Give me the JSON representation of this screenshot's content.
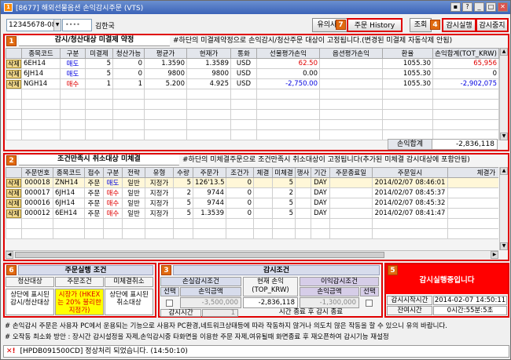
{
  "window": {
    "title": "[8677] 해외선물옵션 손익감시주문 (VTS)"
  },
  "topbar": {
    "account": "12345678-08",
    "password_mask": "••••",
    "user_name": "김한국",
    "notice_button": "유의사항",
    "history_button": "주문 History",
    "lookup_button": "조회",
    "start_button": "감시실행",
    "stop_button": "감시중지"
  },
  "badges": {
    "history": "7",
    "run": "4",
    "p1": "1",
    "p2": "2",
    "p6": "6",
    "p3": "3",
    "p5": "5"
  },
  "panel1": {
    "title": "감시/청산대상 미결제 약정",
    "note": "#하단의 미결제약정으로 손익감시/청산주문 대상이 고정됩니다.(변경된 미결제 자동삭제 안됨)",
    "columns": [
      "",
      "종목코드",
      "구분",
      "미결제",
      "청산가능",
      "평균가",
      "현재가",
      "통화",
      "선물평가손익",
      "옵션평가손익",
      "환율",
      "손익합계(TOT_KRW)"
    ],
    "rows": [
      {
        "del": "삭제",
        "code": "6EH14",
        "side": "매도",
        "open": "5",
        "avail": "0",
        "avg": "1.3590",
        "cur": "1.3589",
        "ccy": "USD",
        "fut_pl": "62.50",
        "opt_pl": "",
        "fx": "1055.30",
        "total": "65,956"
      },
      {
        "del": "삭제",
        "code": "6JH14",
        "side": "매도",
        "open": "5",
        "avail": "0",
        "avg": "9800",
        "cur": "9800",
        "ccy": "USD",
        "fut_pl": "0.00",
        "opt_pl": "",
        "fx": "1055.30",
        "total": "0"
      },
      {
        "del": "삭제",
        "code": "NGH14",
        "side": "매수",
        "open": "1",
        "avail": "1",
        "avg": "5.200",
        "cur": "4.925",
        "ccy": "USD",
        "fut_pl": "-2,750.00",
        "opt_pl": "",
        "fx": "1055.30",
        "total": "-2,902,075"
      }
    ],
    "sum_label": "손익합계",
    "sum_value": "-2,836,118"
  },
  "panel2": {
    "title": "조건만족시 취소대상 미체결",
    "note": "#하단의 미체결주문으로 조건만족시 취소대상이 고정됩니다(추가된 미체결 감시대상에 포함안됨)",
    "columns": [
      "",
      "주문번호",
      "종목코드",
      "접수",
      "구분",
      "전략",
      "유형",
      "수량",
      "주문가",
      "조건가",
      "체결",
      "미체결",
      "행사",
      "기간",
      "주문종료일",
      "주문일시",
      "체결가"
    ],
    "rows": [
      {
        "del": "삭제",
        "no": "000018",
        "code": "ZNH14",
        "rcv": "주문",
        "side": "매도",
        "strat": "일반",
        "type": "지정가",
        "qty": "5",
        "price": "126'13.5",
        "cond": "0",
        "fill": "",
        "unfilled": "5",
        "ex": "",
        "period": "DAY",
        "end": "",
        "time": "2014/02/07 08:46:01",
        "fillp": ""
      },
      {
        "del": "삭제",
        "no": "000017",
        "code": "6JH14",
        "rcv": "주문",
        "side": "매수",
        "strat": "일반",
        "type": "지정가",
        "qty": "2",
        "price": "9744",
        "cond": "0",
        "fill": "",
        "unfilled": "2",
        "ex": "",
        "period": "DAY",
        "end": "",
        "time": "2014/02/07 08:45:37",
        "fillp": ""
      },
      {
        "del": "삭제",
        "no": "000016",
        "code": "6JH14",
        "rcv": "주문",
        "side": "매수",
        "strat": "일반",
        "type": "지정가",
        "qty": "5",
        "price": "9744",
        "cond": "0",
        "fill": "",
        "unfilled": "5",
        "ex": "",
        "period": "DAY",
        "end": "",
        "time": "2014/02/07 08:45:32",
        "fillp": ""
      },
      {
        "del": "삭제",
        "no": "000012",
        "code": "6EH14",
        "rcv": "주문",
        "side": "매수",
        "strat": "일반",
        "type": "지정가",
        "qty": "5",
        "price": "1.3539",
        "cond": "0",
        "fill": "",
        "unfilled": "5",
        "ex": "",
        "period": "DAY",
        "end": "",
        "time": "2014/02/07 08:41:47",
        "fillp": ""
      }
    ]
  },
  "panel6": {
    "title": "주문실행 조건",
    "cols": [
      "청산대상",
      "주문조건",
      "미체결취소"
    ],
    "col1": "상단에 표시된 감시/청산대상",
    "col2": "시장가 (HKEX는 20% 불리한 지정가)",
    "col3": "상단에 표시된 취소대상"
  },
  "panel3": {
    "title": "감시조건",
    "loss_head": "손실감시조건",
    "select_label": "선택",
    "amount_label": "손익금액",
    "loss_value": "-3,500,000",
    "current_label": "현재 손익 (TOP_KRW)",
    "current_value": "-2,836,118",
    "profit_head": "이익감시조건",
    "profit_value": "-1,300,000",
    "time_label": "감시시간",
    "time_value": "1",
    "time_note": "시간 종료 후 감시 종료"
  },
  "panel5": {
    "banner": "감시실행중입니다",
    "start_label": "감시시작시간",
    "start_value": "2014-02-07  14:50:11",
    "remain_label": "잔여시간",
    "remain_value": "0시간:55분:5초"
  },
  "notes": {
    "line1": "# 손익감시 주문은 사용자 PC에서 운용되는 기능으로 사용자 PC환경,네트워크상태등에 따라 작동하지 않거나 의도치 않은 작동을 할 수 있으니 유의 바랍니다.",
    "line2": "# 오작동 최소화 방안 : 장시간 감시설정을 자제,손익감시중 타화면을 이용한 주문 자제,여유될때 화면종료 후 재오픈하여 감시기능 재설정"
  },
  "status": {
    "text": "[HPDB091500CD] 정상처리 되었습니다. (14:50:10)"
  },
  "colors": {
    "accent_red": "#e00000",
    "badge_orange": "#e06a10",
    "blue": "#0000e0"
  }
}
